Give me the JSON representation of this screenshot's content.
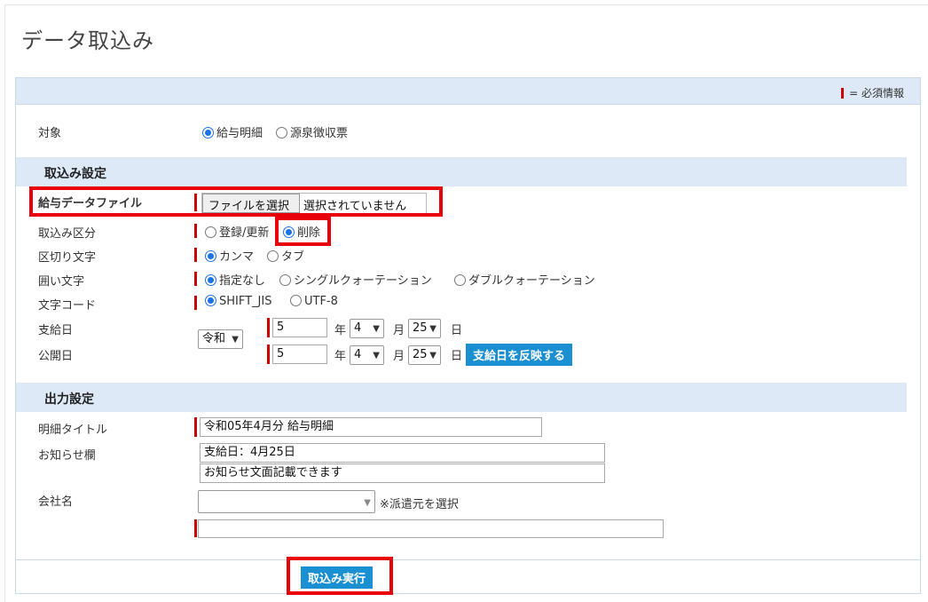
{
  "page": {
    "title": "データ取込み"
  },
  "legend": {
    "required": "= 必須情報"
  },
  "target": {
    "label": "対象",
    "options": [
      "給与明細",
      "源泉徴収票"
    ],
    "selected": 0
  },
  "import_settings": {
    "section_title": "取込み設定",
    "file": {
      "label": "給与データファイル",
      "button": "ファイルを選択",
      "status": "選択されていません"
    },
    "mode": {
      "label": "取込み区分",
      "options": [
        "登録/更新",
        "削除"
      ],
      "selected": 1
    },
    "delimiter": {
      "label": "区切り文字",
      "options": [
        "カンマ",
        "タブ"
      ],
      "selected": 0
    },
    "enclosure": {
      "label": "囲い文字",
      "options": [
        "指定なし",
        "シングルクォーテーション",
        "ダブルクォーテーション"
      ],
      "selected": 0
    },
    "encoding": {
      "label": "文字コード",
      "options": [
        "SHIFT_JIS",
        "UTF-8"
      ],
      "selected": 0
    },
    "era": "令和",
    "pay_date": {
      "label": "支給日",
      "year": "5",
      "month": "4",
      "day": "25"
    },
    "publish_date": {
      "label": "公開日",
      "year": "5",
      "month": "4",
      "day": "25"
    },
    "unit_year": "年",
    "unit_month": "月",
    "unit_day": "日",
    "reflect_button": "支給日を反映する"
  },
  "output_settings": {
    "section_title": "出力設定",
    "title": {
      "label": "明細タイトル",
      "value": "令和05年4月分 給与明細"
    },
    "notice": {
      "label": "お知らせ欄",
      "line1": "支給日：4月25日",
      "line2": "お知らせ文面記載できます"
    },
    "company": {
      "label": "会社名",
      "hint": "※派遣元を選択",
      "value": ""
    }
  },
  "execute_button": "取込み実行",
  "colors": {
    "accent": "#1a8fd1",
    "required": "#cc0000",
    "highlight": "#e8000b",
    "section_bg": "#dde9f6"
  }
}
